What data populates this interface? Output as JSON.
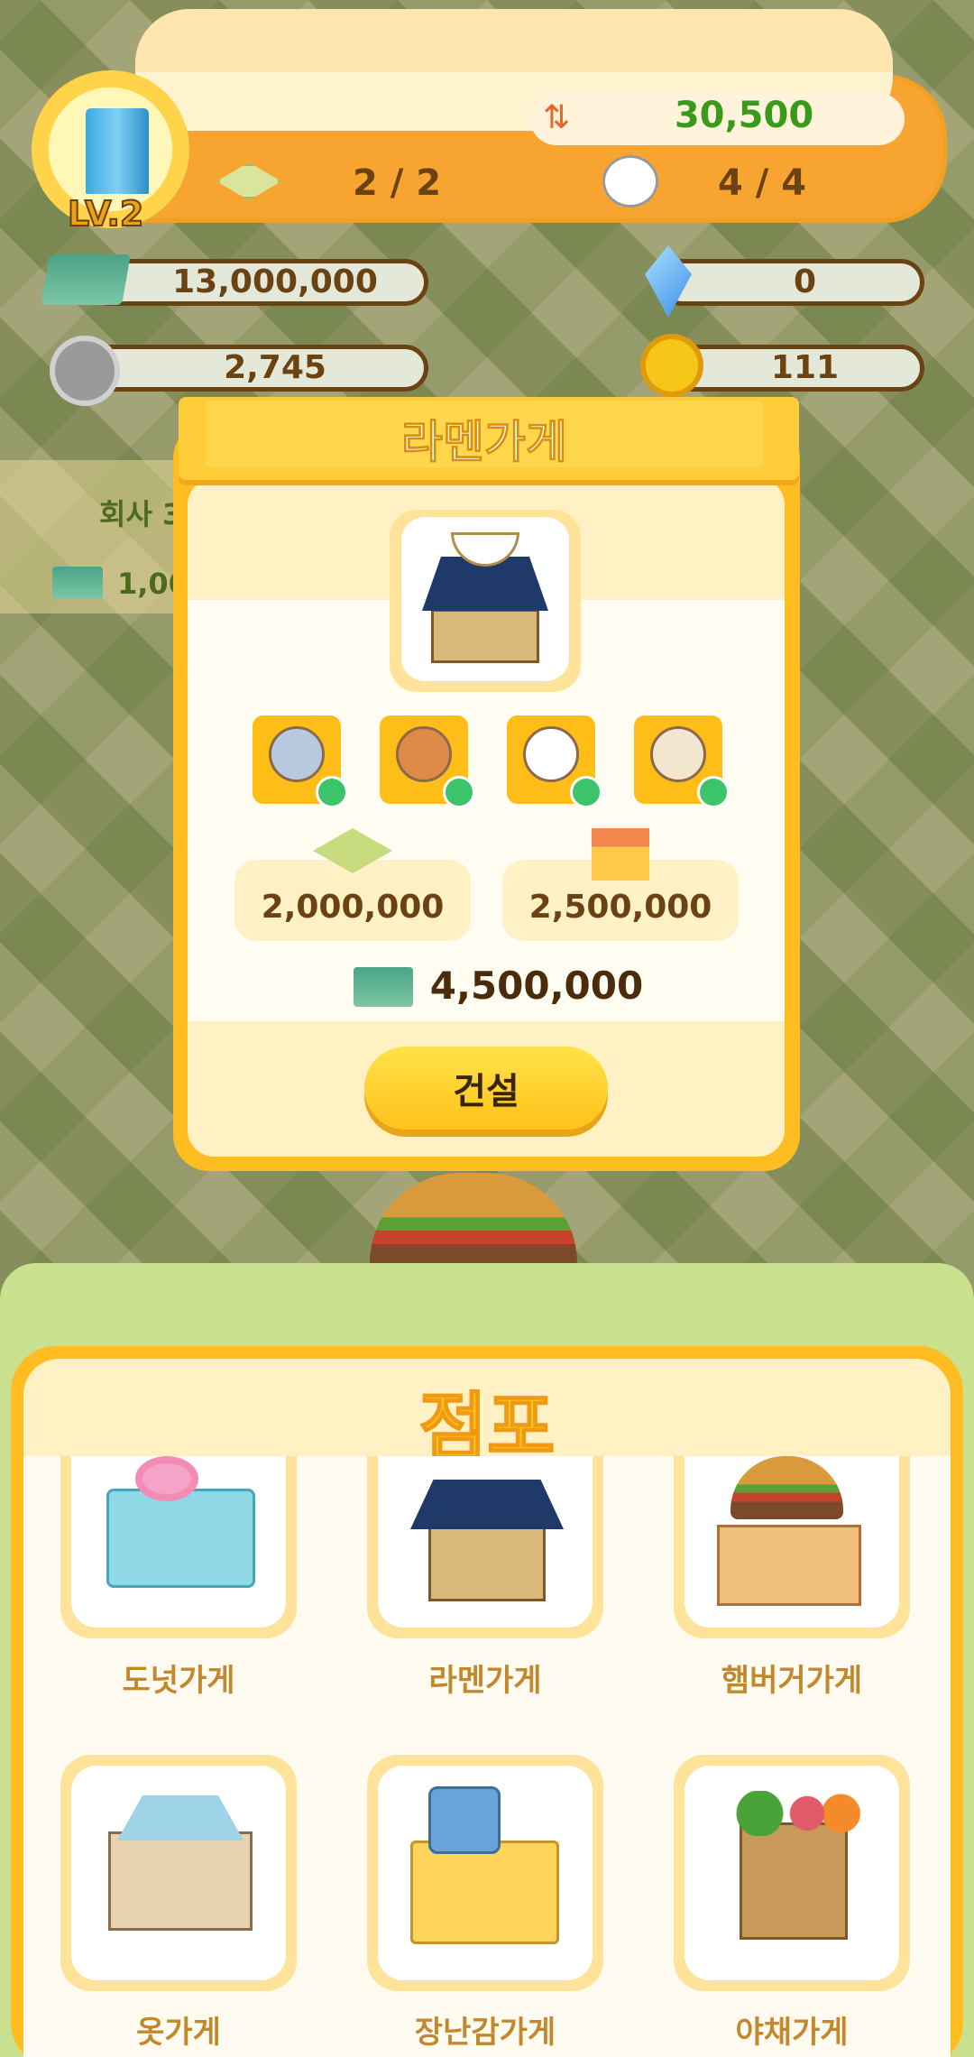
{
  "hud": {
    "level": "LV.2",
    "population": "30,500",
    "land": "2 / 2",
    "staff": "4 / 4"
  },
  "resources": {
    "cash": "13,000,000",
    "gem": "0",
    "coin": "2,745",
    "key": "111"
  },
  "background": {
    "label_partial": "회사 3",
    "cash_partial": "1,00"
  },
  "modal": {
    "title": "라멘가게",
    "land_cost": "2,000,000",
    "build_cost": "2,500,000",
    "total": "4,500,000",
    "build_button": "건설"
  },
  "panel": {
    "title": "점포",
    "shops": [
      {
        "name": "도넛가게"
      },
      {
        "name": "라멘가게"
      },
      {
        "name": "햄버거가게"
      },
      {
        "name": "옷가게"
      },
      {
        "name": "장난감가게"
      },
      {
        "name": "야채가게"
      }
    ]
  },
  "colors": {
    "accent": "#ffbd22",
    "money_text": "#6b4312",
    "population_text": "#3a9a1c"
  }
}
